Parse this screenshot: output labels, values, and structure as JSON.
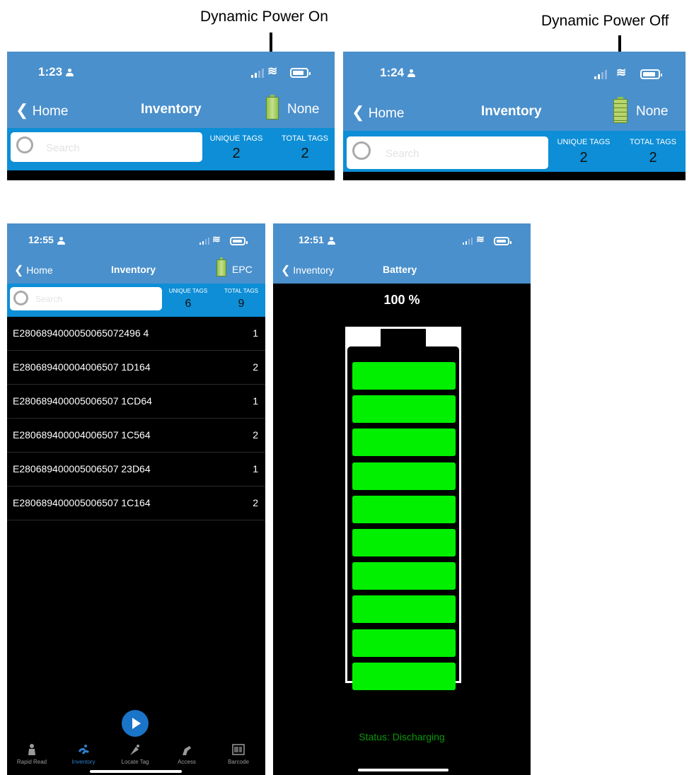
{
  "captions": {
    "power_on": "Dynamic Power On",
    "power_off": "Dynamic Power Off"
  },
  "top_left": {
    "time": "1:23",
    "back": "Home",
    "title": "Inventory",
    "right_label": "None",
    "search_placeholder": "Search",
    "unique_label": "UNIQUE TAGS",
    "total_label": "TOTAL TAGS",
    "unique": "2",
    "total": "2"
  },
  "top_right": {
    "time": "1:24",
    "back": "Home",
    "title": "Inventory",
    "right_label": "None",
    "search_placeholder": "Search",
    "unique_label": "UNIQUE TAGS",
    "total_label": "TOTAL TAGS",
    "unique": "2",
    "total": "2"
  },
  "inventory": {
    "time": "12:55",
    "back": "Home",
    "title": "Inventory",
    "right_label": "EPC",
    "search_placeholder": "Search",
    "unique_label": "UNIQUE TAGS",
    "total_label": "TOTAL TAGS",
    "unique": "6",
    "total": "9",
    "rows": [
      {
        "epc": "E2806894000050065072496 4",
        "count": "1"
      },
      {
        "epc": "E280689400004006507 1D164",
        "count": "2"
      },
      {
        "epc": "E280689400005006507 1CD64",
        "count": "1"
      },
      {
        "epc": "E280689400004006507 1C564",
        "count": "2"
      },
      {
        "epc": "E280689400005006507 23D64",
        "count": "1"
      },
      {
        "epc": "E280689400005006507 1C164",
        "count": "2"
      }
    ],
    "tabs": [
      "Rapid Read",
      "Inventory",
      "Locate Tag",
      "Access",
      "Barcode"
    ]
  },
  "battery": {
    "time": "12:51",
    "back": "Inventory",
    "title": "Battery",
    "percent": "100 %",
    "level": 1.0,
    "cells": 10,
    "status": "Status: Discharging"
  },
  "colors": {
    "nav_blue": "#4a90cc",
    "strip_blue": "#0d8ed6",
    "cell_green": "#00f000",
    "play_blue": "#1a74c8"
  }
}
